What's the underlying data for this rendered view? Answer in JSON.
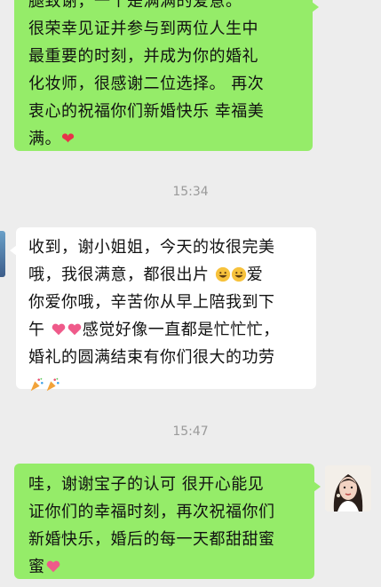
{
  "messages": [
    {
      "sender": "self",
      "lines": [
        "腿致谢，一个是满满的爱意。",
        "很荣幸见证并参与到两位人生中",
        "最重要的时刻，并成为你的婚礼",
        "化妆师，很感谢二位选择。 再次",
        "衷心的祝福你们新婚快乐 幸福美",
        "满。"
      ],
      "end_emoji": "red-heart"
    },
    {
      "time": "15:34"
    },
    {
      "sender": "other",
      "lines": [
        "收到，谢小姐姐，今天的妆很完美",
        "哦，我很满意，都很出片",
        "爱",
        "你爱你哦，辛苦你从早上陪我到下",
        "午",
        "感觉好像一直都是忙忙忙，",
        "婚礼的圆满结束有你们很大的功劳"
      ]
    },
    {
      "time": "15:47"
    },
    {
      "sender": "self",
      "lines": [
        "哇，谢谢宝子的认可  很开心能见",
        "证你们的幸福时刻，再次祝福你们",
        "新婚快乐，婚后的每一天都甜甜蜜",
        "蜜"
      ]
    }
  ],
  "colors": {
    "outgoing_bubble": "#95ec69",
    "incoming_bubble": "#ffffff",
    "background": "#ededed",
    "timestamp": "#9a9a9a"
  }
}
